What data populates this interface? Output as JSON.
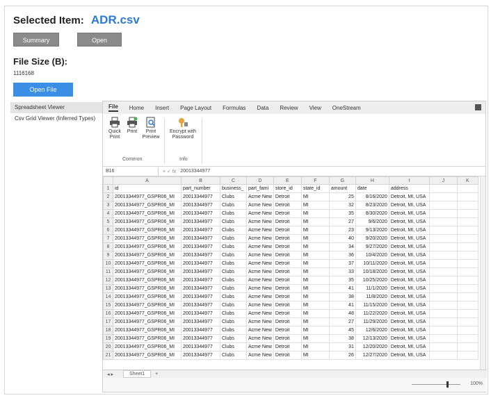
{
  "header": {
    "selected_label": "Selected Item:",
    "file_name": "ADR.csv",
    "summary_button": "Summary",
    "open_button": "Open",
    "file_size_label": "File Size (B):",
    "file_size_value": "1116168",
    "open_file_button": "Open File"
  },
  "sidebar": {
    "items": [
      {
        "label": "Spreadsheet Viewer",
        "active": true
      },
      {
        "label": "Csv Grid Viewer (Inferred Types)",
        "active": false
      }
    ]
  },
  "menu": {
    "items": [
      "File",
      "Home",
      "Insert",
      "Page Layout",
      "Formulas",
      "Data",
      "Review",
      "View",
      "OneStream"
    ]
  },
  "ribbon": {
    "quick_print": "Quick Print",
    "print": "Print",
    "print_preview": "Print Preview",
    "encrypt": "Encrypt with Password",
    "group_common": "Common",
    "group_info": "Info"
  },
  "formula_bar": {
    "cell_ref": "B16",
    "value": "20013344977"
  },
  "grid": {
    "columns": [
      "A",
      "B",
      "C",
      "D",
      "E",
      "F",
      "G",
      "H",
      "I",
      "J",
      "K"
    ],
    "header_row": [
      "id",
      "part_number",
      "business_",
      "part_fami",
      "store_id",
      "state_id",
      "amount",
      "date",
      "address",
      "",
      ""
    ],
    "rows": [
      [
        "20013344977_GSPR06_MI",
        "20013344977",
        "Clubs",
        "Acme New",
        "Detroit",
        "MI",
        "25",
        "8/16/2020",
        "Detroit, MI, USA",
        "",
        ""
      ],
      [
        "20013344977_GSPR06_MI",
        "20013344977",
        "Clubs",
        "Acme New",
        "Detroit",
        "MI",
        "32",
        "8/23/2020",
        "Detroit, MI, USA",
        "",
        ""
      ],
      [
        "20013344977_GSPR06_MI",
        "20013344977",
        "Clubs",
        "Acme New",
        "Detroit",
        "MI",
        "35",
        "8/30/2020",
        "Detroit, MI, USA",
        "",
        ""
      ],
      [
        "20013344977_GSPR06_MI",
        "20013344977",
        "Clubs",
        "Acme New",
        "Detroit",
        "MI",
        "27",
        "9/6/2020",
        "Detroit, MI, USA",
        "",
        ""
      ],
      [
        "20013344977_GSPR06_MI",
        "20013344977",
        "Clubs",
        "Acme New",
        "Detroit",
        "MI",
        "23",
        "9/13/2020",
        "Detroit, MI, USA",
        "",
        ""
      ],
      [
        "20013344977_GSPR06_MI",
        "20013344977",
        "Clubs",
        "Acme New",
        "Detroit",
        "MI",
        "40",
        "9/20/2020",
        "Detroit, MI, USA",
        "",
        ""
      ],
      [
        "20013344977_GSPR06_MI",
        "20013344977",
        "Clubs",
        "Acme New",
        "Detroit",
        "MI",
        "34",
        "9/27/2020",
        "Detroit, MI, USA",
        "",
        ""
      ],
      [
        "20013344977_GSPR06_MI",
        "20013344977",
        "Clubs",
        "Acme New",
        "Detroit",
        "MI",
        "36",
        "10/4/2020",
        "Detroit, MI, USA",
        "",
        ""
      ],
      [
        "20013344977_GSPR06_MI",
        "20013344977",
        "Clubs",
        "Acme New",
        "Detroit",
        "MI",
        "37",
        "10/11/2020",
        "Detroit, MI, USA",
        "",
        ""
      ],
      [
        "20013344977_GSPR06_MI",
        "20013344977",
        "Clubs",
        "Acme New",
        "Detroit",
        "MI",
        "33",
        "10/18/2020",
        "Detroit, MI, USA",
        "",
        ""
      ],
      [
        "20013344977_GSPR06_MI",
        "20013344977",
        "Clubs",
        "Acme New",
        "Detroit",
        "MI",
        "35",
        "10/25/2020",
        "Detroit, MI, USA",
        "",
        ""
      ],
      [
        "20013344977_GSPR06_MI",
        "20013344977",
        "Clubs",
        "Acme New",
        "Detroit",
        "MI",
        "41",
        "11/1/2020",
        "Detroit, MI, USA",
        "",
        ""
      ],
      [
        "20013344977_GSPR06_MI",
        "20013344977",
        "Clubs",
        "Acme New",
        "Detroit",
        "MI",
        "38",
        "11/8/2020",
        "Detroit, MI, USA",
        "",
        ""
      ],
      [
        "20013344977_GSPR06_MI",
        "20013344977",
        "Clubs",
        "Acme New",
        "Detroit",
        "MI",
        "41",
        "11/15/2020",
        "Detroit, MI, USA",
        "",
        ""
      ],
      [
        "20013344977_GSPR06_MI",
        "20013344977",
        "Clubs",
        "Acme New",
        "Detroit",
        "MI",
        "48",
        "11/22/2020",
        "Detroit, MI, USA",
        "",
        ""
      ],
      [
        "20013344977_GSPR06_MI",
        "20013344977",
        "Clubs",
        "Acme New",
        "Detroit",
        "MI",
        "27",
        "11/29/2020",
        "Detroit, MI, USA",
        "",
        ""
      ],
      [
        "20013344977_GSPR06_MI",
        "20013344977",
        "Clubs",
        "Acme New",
        "Detroit",
        "MI",
        "45",
        "12/6/2020",
        "Detroit, MI, USA",
        "",
        ""
      ],
      [
        "20013344977_GSPR06_MI",
        "20013344977",
        "Clubs",
        "Acme New",
        "Detroit",
        "MI",
        "38",
        "12/13/2020",
        "Detroit, MI, USA",
        "",
        ""
      ],
      [
        "20013344977_GSPR06_MI",
        "20013344977",
        "Clubs",
        "Acme New",
        "Detroit",
        "MI",
        "31",
        "12/20/2020",
        "Detroit, MI, USA",
        "",
        ""
      ],
      [
        "20013344977_GSPR06_MI",
        "20013344977",
        "Clubs",
        "Acme New",
        "Detroit",
        "MI",
        "26",
        "12/27/2020",
        "Detroit, MI, USA",
        "",
        ""
      ]
    ]
  },
  "sheet_tab": "Sheet1",
  "zoom": {
    "label": "100%",
    "level": 100
  }
}
